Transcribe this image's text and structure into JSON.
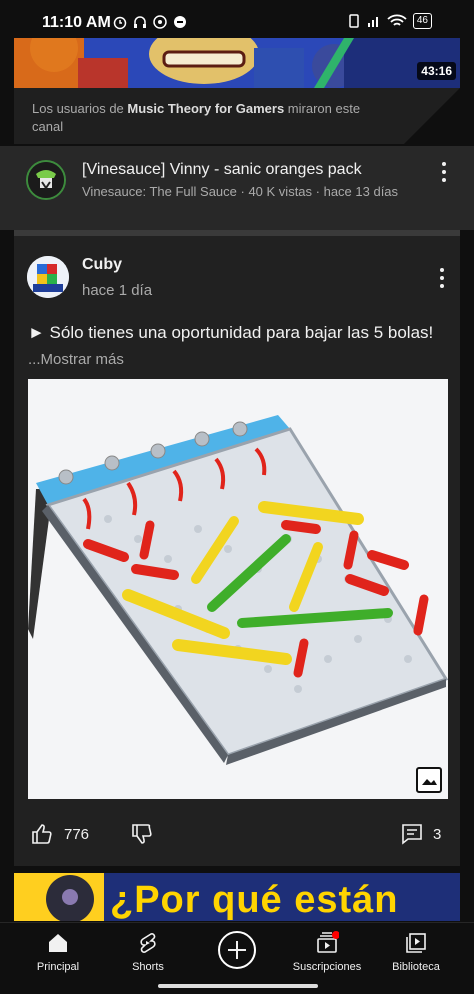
{
  "status_bar": {
    "time": "11:10 AM",
    "battery": "46"
  },
  "top_video": {
    "duration": "43:16"
  },
  "shelf": {
    "reason_prefix": "Los usuarios de ",
    "reason_channel": "Music Theory for Gamers",
    "reason_suffix": " miraron este canal"
  },
  "video": {
    "title": "[Vinesauce] Vinny - sanic oranges pack",
    "meta": "Vinesauce: The Full Sauce · 40 K vistas · hace 13 días"
  },
  "post": {
    "author": "Cuby",
    "date": "hace 1 día",
    "text": "► Sólo tienes una oportunidad para bajar las 5 bolas!",
    "more": "...Mostrar más",
    "likes": "776",
    "comments": "3"
  },
  "next_video": {
    "thumb_text": "¿Por qué están"
  },
  "bottom_nav": {
    "home": "Principal",
    "shorts": "Shorts",
    "subscriptions": "Suscripciones",
    "library": "Biblioteca"
  },
  "colors": {
    "accent": "#ff0000",
    "background": "#0f0f0f",
    "card": "#212121"
  }
}
